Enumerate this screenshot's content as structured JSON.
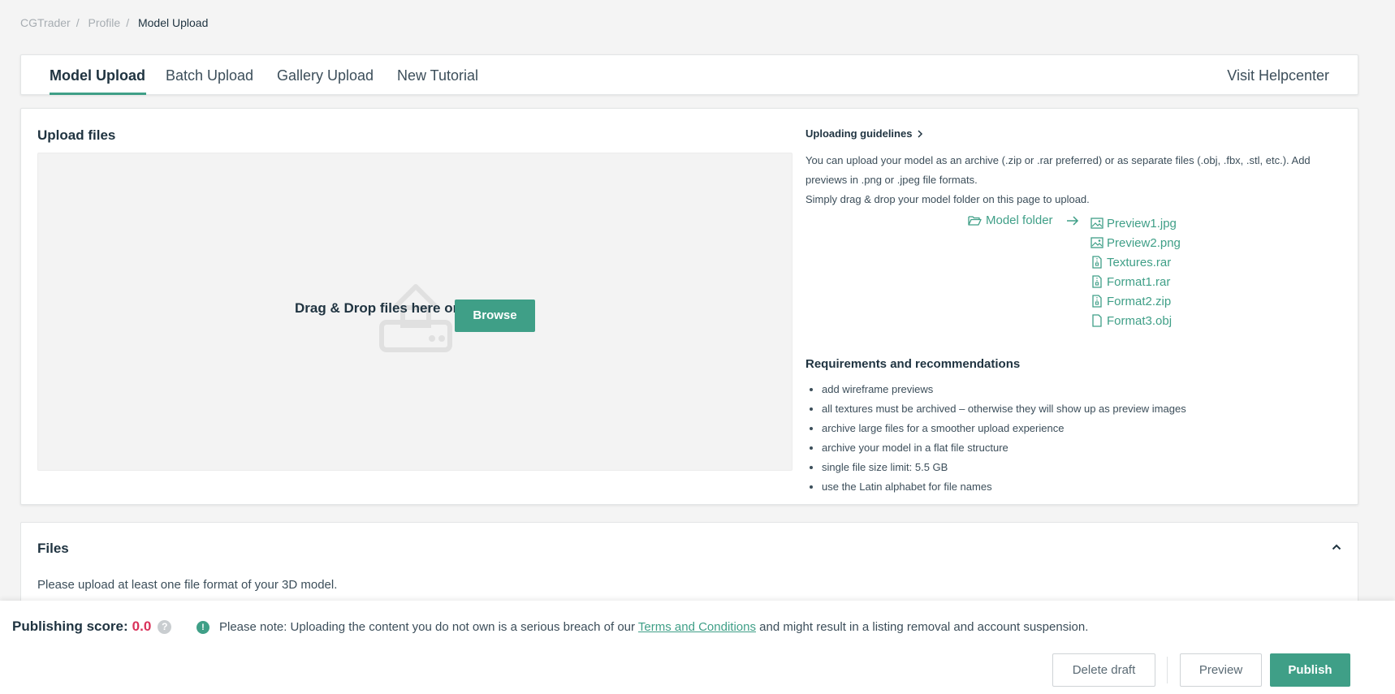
{
  "breadcrumb": {
    "items": [
      "CGTrader",
      "Profile"
    ],
    "current": "Model Upload"
  },
  "tabs": [
    {
      "label": "Model Upload",
      "active": true
    },
    {
      "label": "Batch Upload",
      "active": false
    },
    {
      "label": "Gallery Upload",
      "active": false
    },
    {
      "label": "New Tutorial",
      "active": false
    }
  ],
  "help_link": "Visit Helpcenter",
  "upload": {
    "title": "Upload files",
    "drop_text": "Drag & Drop files here or",
    "browse_label": "Browse"
  },
  "guidelines": {
    "title": "Uploading guidelines",
    "text1": "You can upload your model as an archive (.zip or .rar preferred) or as separate files (.obj, .fbx, .stl, etc.). Add previews in .png or .jpeg file formats.",
    "text2": "Simply drag & drop your model folder on this page to upload.",
    "folder": "Model folder",
    "files": [
      {
        "name": "Preview1.jpg",
        "icon": "image-file-icon"
      },
      {
        "name": "Preview2.png",
        "icon": "image-file-icon"
      },
      {
        "name": "Textures.rar",
        "icon": "archive-file-icon"
      },
      {
        "name": "Format1.rar",
        "icon": "archive-file-icon"
      },
      {
        "name": "Format2.zip",
        "icon": "archive-file-icon"
      },
      {
        "name": "Format3.obj",
        "icon": "file-icon"
      }
    ]
  },
  "requirements": {
    "title": "Requirements and recommendations",
    "items": [
      "add wireframe previews",
      "all textures must be archived – otherwise they will show up as preview images",
      "archive large files for a smoother upload experience",
      "archive your model in a flat file structure",
      "single file size limit: 5.5 GB",
      "use the Latin alphabet for file names"
    ]
  },
  "files_section": {
    "title": "Files",
    "note": "Please upload at least one file format of your 3D model."
  },
  "bottom": {
    "score_label": "Publishing score:",
    "score_value": "0.0",
    "notice_before": "Please note: Uploading the content you do not own is a serious breach of our",
    "notice_link": "Terms and Conditions",
    "notice_after": "and might result in a listing removal and account suspension.",
    "delete_label": "Delete draft",
    "preview_label": "Preview",
    "publish_label": "Publish"
  },
  "colors": {
    "accent": "#3f9f87",
    "score": "#d9325a",
    "text": "#1f3340"
  }
}
